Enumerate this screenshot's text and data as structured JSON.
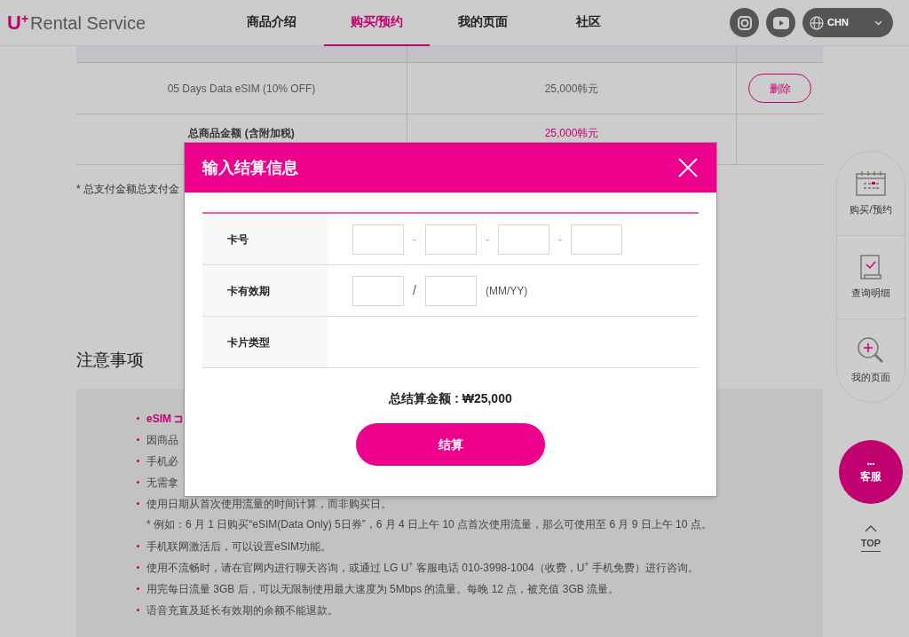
{
  "header": {
    "logo": {
      "letter": "U",
      "sup": "+",
      "text": "Rental Service"
    },
    "nav": [
      {
        "label": "商品介绍",
        "selected": false
      },
      {
        "label": "购买/预约",
        "selected": true
      },
      {
        "label": "我的页面",
        "selected": false
      },
      {
        "label": "社区",
        "selected": false
      }
    ],
    "language": "CHN"
  },
  "cart": {
    "rows": [
      {
        "name": "05 Days Data eSIM (10% OFF)",
        "price": "25,000韩元",
        "action": "删除"
      }
    ],
    "total": {
      "label": "总商品金额 (含附加税)",
      "value": "25,000韩元"
    }
  },
  "footnote": "* 总支付金额总支付金",
  "notice": {
    "title": "注意事项",
    "items": [
      {
        "text": "eSIM ⊐",
        "highlight": true
      },
      {
        "text": "因商品",
        "highlight": false
      },
      {
        "text": "手机必",
        "highlight": false
      },
      {
        "text": "无需拿",
        "highlight": false
      },
      {
        "text": "使用日期从首次使用流量的时间计算，而非购买日。",
        "highlight": false,
        "note": "* 例如：6 月 1 日购买“eSIM(Data Only) 5日券”，6 月 4 日上午 10 点首次使用流量，那么可使用至 6 月 9 日上午 10 点。"
      },
      {
        "text": "手机联网激活后，可以设置eSIM功能。",
        "highlight": false
      },
      {
        "text": "使用不流畅时，请在官网内进行聊天咨询，或通过 LG U$^{+}$ 客服电话 010-3998-1004（收费，U$^{+}$ 手机免费）进行咨询。",
        "highlight": false
      },
      {
        "text": "用完每日流量 3GB 后，可以无限制使用最大速度为 5Mbps 的流量。每晚 12 点，被充值 3GB 流量。",
        "highlight": false
      },
      {
        "text": "语音充直及延长有效期的余额不能退款。",
        "highlight": false
      }
    ]
  },
  "quick_menu": {
    "items": [
      {
        "kind": "calendar",
        "label": "购买/预约"
      },
      {
        "kind": "document",
        "label": "查询明细"
      },
      {
        "kind": "magnifier",
        "label": "我的页面"
      }
    ],
    "chat": {
      "dots": "•••",
      "label": "客服"
    },
    "top": "TOP"
  },
  "modal": {
    "title": "输入结算信息",
    "rows": [
      {
        "kind": "card_number",
        "label": "卡号",
        "separators": [
          "-",
          "-",
          "-"
        ]
      },
      {
        "kind": "expiry",
        "label": "卡有效期",
        "separator": "/",
        "hint": "(MM/YY)"
      },
      {
        "kind": "plain",
        "label": "卡片类型"
      }
    ],
    "total": "总结算金额 : ₩25,000",
    "button": "结算"
  }
}
